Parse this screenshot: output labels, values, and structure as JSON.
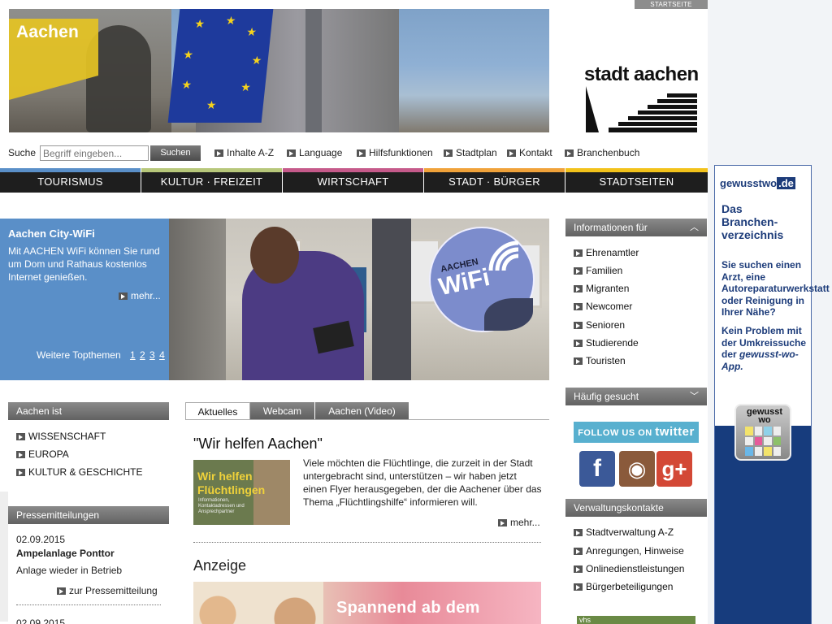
{
  "header": {
    "startseite": "STARTSEITE",
    "banner_title": "Aachen",
    "logo_text": "stadt aachen"
  },
  "search": {
    "label": "Suche",
    "placeholder": "Begriff eingeben...",
    "button": "Suchen"
  },
  "util_links": [
    "Inhalte A-Z",
    "Language",
    "Hilfsfunktionen",
    "Stadtplan",
    "Kontakt",
    "Branchenbuch"
  ],
  "nav": {
    "items": [
      {
        "label": "TOURISMUS",
        "color": "#5a8fc8"
      },
      {
        "label": "KULTUR · FREIZEIT",
        "color": "#b7c77a"
      },
      {
        "label": "WIRTSCHAFT",
        "color": "#c55a8a"
      },
      {
        "label": "STADT · BÜRGER",
        "color": "#f0a23a"
      },
      {
        "label": "STADTSEITEN",
        "color": "#f2c21b"
      }
    ]
  },
  "topthema": {
    "title": "Aachen City-WiFi",
    "text": "Mit AACHEN WiFi können Sie rund um Dom und Rathaus kostenlos Internet genießen.",
    "more": "mehr...",
    "weitere": "Weitere Topthemen",
    "pages": [
      "1",
      "2",
      "3",
      "4"
    ],
    "badge_small": "AACHEN",
    "badge_big": "WiFi"
  },
  "aachen_ist": {
    "header": "Aachen ist",
    "items": [
      "WISSENSCHAFT",
      "EUROPA",
      "KULTUR & GESCHICHTE"
    ]
  },
  "press": {
    "header": "Pressemitteilungen",
    "items": [
      {
        "date": "02.09.2015",
        "title": "Ampelanlage Ponttor",
        "text": "Anlage wieder in Betrieb",
        "link": "zur Pressemitteilung"
      },
      {
        "date": "02.09.2015"
      }
    ]
  },
  "tabs": [
    "Aktuelles",
    "Webcam",
    "Aachen (Video)"
  ],
  "article": {
    "title": "\"Wir helfen Aachen\"",
    "img_title": "Wir helfen Flüchtlingen",
    "img_sub": "Informationen, Kontaktadressen und Ansprechpartner",
    "text": "Viele möchten die Flüchtlinge, die zurzeit in der Stadt untergebracht sind, unterstützen – wir haben jetzt einen Flyer herausgegeben, der die Aachener über das Thema „Flüchtlingshilfe“ informieren will.",
    "more": "mehr..."
  },
  "anzeige": {
    "title": "Anzeige",
    "ad_text": "Spannend ab dem"
  },
  "info_fuer": {
    "header": "Informationen für",
    "items": [
      "Ehrenamtler",
      "Familien",
      "Migranten",
      "Newcomer",
      "Senioren",
      "Studierende",
      "Touristen"
    ]
  },
  "haeufig": {
    "header": "Häufig gesucht",
    "twitter_prefix": "FOLLOW US ON",
    "twitter_brand": "twitter",
    "social": [
      {
        "name": "facebook-icon",
        "glyph": "f",
        "color": "#3b5998"
      },
      {
        "name": "instagram-icon",
        "glyph": "◉",
        "color": "#8a5a3b"
      },
      {
        "name": "googleplus-icon",
        "glyph": "g+",
        "color": "#d34836"
      }
    ]
  },
  "verwaltung": {
    "header": "Verwaltungskontakte",
    "items": [
      "Stadtverwaltung A-Z",
      "Anregungen, Hinweise",
      "Onlinedienstleistungen",
      "Bürgerbeteiligungen"
    ],
    "banner": "vhs"
  },
  "gewusst": {
    "logo_a": "gewusst",
    "logo_b": "wo",
    "logo_c": ".de",
    "headline": "Das Branchen-verzeichnis",
    "text1": "Sie suchen einen Arzt, eine Autoreparaturwerkstatt oder Reinigung in Ihrer Nähe?",
    "text2a": "Kein Problem mit der Umkreissuche der",
    "text2b": "gewusst-wo-App.",
    "app_label": "gewusst wo"
  }
}
